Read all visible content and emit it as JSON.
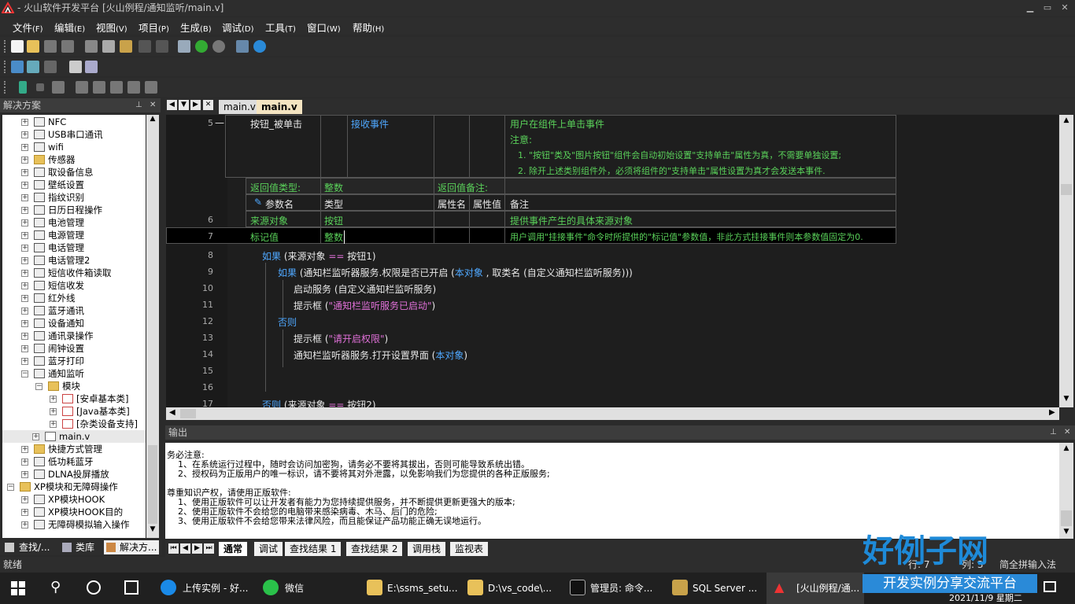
{
  "window": {
    "title": "- 火山软件开发平台 [火山例程/通知监听/main.v]",
    "controls": [
      "▁",
      "▭",
      "✕"
    ]
  },
  "menu": [
    {
      "label": "文件",
      "key": "(F)"
    },
    {
      "label": "编辑",
      "key": "(E)"
    },
    {
      "label": "视图",
      "key": "(V)"
    },
    {
      "label": "项目",
      "key": "(P)"
    },
    {
      "label": "生成",
      "key": "(B)"
    },
    {
      "label": "调试",
      "key": "(D)"
    },
    {
      "label": "工具",
      "key": "(T)"
    },
    {
      "label": "窗口",
      "key": "(W)"
    },
    {
      "label": "帮助",
      "key": "(H)"
    }
  ],
  "solution": {
    "title": "解决方案",
    "items": [
      "NFC",
      "USB串口通讯",
      "wifi",
      "传感器",
      "取设备信息",
      "壁纸设置",
      "指纹识别",
      "日历日程操作",
      "电池管理",
      "电源管理",
      "电话管理",
      "电话管理2",
      "短信收件箱读取",
      "短信收发",
      "红外线",
      "蓝牙通讯",
      "设备通知",
      "通讯录操作",
      "闹钟设置",
      "蓝牙打印",
      "通知监听"
    ],
    "module_folder": "模块",
    "module_children": [
      "[安卓基本类]",
      "[Java基本类]",
      "[杂类设备支持]"
    ],
    "main_file": "main.v",
    "items_after": [
      "快捷方式管理",
      "低功耗蓝牙",
      "DLNA投屏播放"
    ],
    "xp_group": "XP模块和无障碍操作",
    "xp_items": [
      "XP模块HOOK",
      "XP模块HOOK目的",
      "无障碍模拟输入操作"
    ],
    "tabs": [
      "查找/...",
      "类库",
      "解决方..."
    ]
  },
  "editor_tabs": [
    "main.v",
    "main.v"
  ],
  "editor": {
    "row5": {
      "num": "5",
      "dash": "—",
      "name": "按钮_被单击",
      "type": "接收事件",
      "note": "用户在组件上单击事件",
      "note2": "注意:",
      "note3": "1. \"按钮\"类及\"图片按钮\"组件会自动初始设置\"支持单击\"属性为真，不需要单独设置;",
      "note4": "2. 除开上述类别组件外，必须将组件的\"支持单击\"属性设置为真才会发送本事件."
    },
    "ret_type_label": "返回值类型:",
    "ret_type": "整数",
    "ret_note_label": "返回值备注:",
    "param_headers": [
      "参数名",
      "类型",
      "属性名",
      "属性值",
      "备注"
    ],
    "row6": {
      "num": "6",
      "name": "来源对象",
      "type": "按钮",
      "note": "提供事件产生的具体来源对象"
    },
    "row7": {
      "num": "7",
      "name": "标记值",
      "type": "整数",
      "note": "用户调用\"挂接事件\"命令时所提供的\"标记值\"参数值，非此方式挂接事件则本参数值固定为0."
    },
    "code": [
      {
        "n": "8",
        "parts": [
          [
            "c",
            "如果"
          ],
          [
            "w",
            " (来源对象 "
          ],
          [
            "pk",
            "=="
          ],
          [
            "w",
            " 按钮1)"
          ]
        ]
      },
      {
        "n": "9",
        "parts": [
          [
            "c",
            "如果"
          ],
          [
            "w",
            " (通知栏监听器服务.权限是否已开启 ("
          ],
          [
            "bl",
            "本对象"
          ],
          [
            "w",
            " , 取类名 (自定义通知栏监听服务)))"
          ]
        ]
      },
      {
        "n": "10",
        "parts": [
          [
            "w",
            "启动服务 (自定义通知栏监听服务)"
          ]
        ]
      },
      {
        "n": "11",
        "parts": [
          [
            "w",
            "提示框 ("
          ],
          [
            "pk",
            "\"通知栏监听服务已启动\""
          ],
          [
            "w",
            ")"
          ]
        ]
      },
      {
        "n": "12",
        "parts": [
          [
            "c",
            "否则"
          ]
        ]
      },
      {
        "n": "13",
        "parts": [
          [
            "w",
            "提示框 ("
          ],
          [
            "pk",
            "\"请开启权限\""
          ],
          [
            "w",
            ")"
          ]
        ]
      },
      {
        "n": "14",
        "parts": [
          [
            "w",
            "通知栏监听器服务.打开设置界面 ("
          ],
          [
            "bl",
            "本对象"
          ],
          [
            "w",
            ")"
          ]
        ]
      },
      {
        "n": "15",
        "parts": []
      },
      {
        "n": "16",
        "parts": []
      },
      {
        "n": "17",
        "parts": [
          [
            "c",
            "否则"
          ],
          [
            "w",
            " (来源对象 "
          ],
          [
            "pk",
            "=="
          ],
          [
            "w",
            " 按钮2)"
          ]
        ]
      }
    ]
  },
  "output": {
    "title": "输出",
    "text": "务必注意:\n    1、在系统运行过程中，随时会访问加密狗，请务必不要将其拔出，否则可能导致系统出错。\n    2、授权码为正版用户的唯一标识，请不要将其对外泄露，以免影响我们为您提供的各种正版服务;\n\n尊重知识产权，请使用正版软件:\n    1、使用正版软件可以让开发者有能力为您持续提供服务，并不断提供更新更强大的版本;\n    2、使用正版软件不会给您的电脑带来感染病毒、木马、后门的危险;\n    3、使用正版软件不会给您带来法律风险，而且能保证产品功能正确无误地运行。",
    "tabs": [
      "通常",
      "调试",
      "查找结果 1",
      "查找结果 2",
      "调用栈",
      "监视表"
    ]
  },
  "status": {
    "left": "就绪",
    "line": "行: 7",
    "col": "列: 3",
    "ime": "简全拼输入法"
  },
  "taskbar": {
    "items": [
      "上传实例 - 好...",
      "微信",
      "E:\\ssms_setu...",
      "D:\\vs_code\\...",
      "管理员: 命令...",
      "SQL Server ...",
      "[火山例程/通..."
    ],
    "date": "2021/11/9 星期二"
  },
  "watermark": {
    "line1": "好例子网",
    "line2": "开发实例分享交流平台",
    "bg": "www.haolizi.com"
  }
}
